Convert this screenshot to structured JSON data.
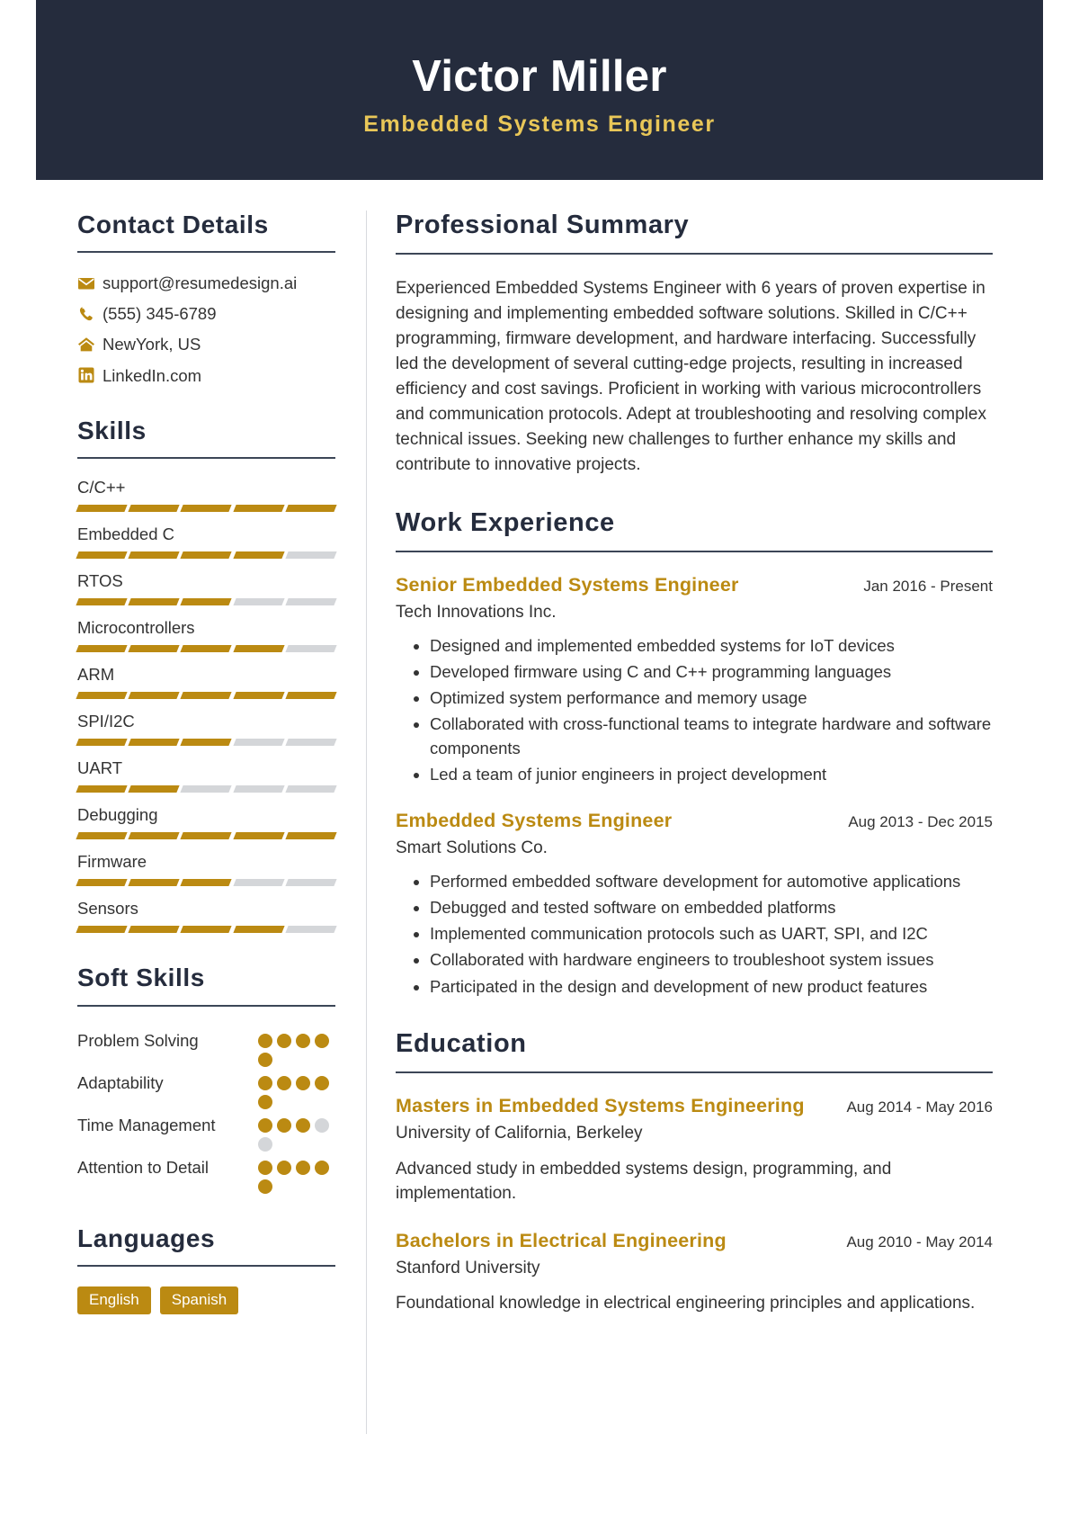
{
  "header": {
    "name": "Victor Miller",
    "title": "Embedded Systems Engineer",
    "bg_color": "#252c3d",
    "accent_color": "#e9c758"
  },
  "accent": {
    "gold": "#bb8a12",
    "navy": "#252c3d",
    "gray": "#d4d6d9"
  },
  "sidebar": {
    "contact": {
      "heading": "Contact Details",
      "items": [
        {
          "icon": "envelope-icon",
          "value": "support@resumedesign.ai"
        },
        {
          "icon": "phone-icon",
          "value": "(555) 345-6789"
        },
        {
          "icon": "home-icon",
          "value": "NewYork, US"
        },
        {
          "icon": "linkedin-icon",
          "value": "LinkedIn.com"
        }
      ]
    },
    "skills": {
      "heading": "Skills",
      "max": 5,
      "items": [
        {
          "name": "C/C++",
          "level": 5
        },
        {
          "name": "Embedded C",
          "level": 4
        },
        {
          "name": "RTOS",
          "level": 3
        },
        {
          "name": "Microcontrollers",
          "level": 4
        },
        {
          "name": "ARM",
          "level": 5
        },
        {
          "name": "SPI/I2C",
          "level": 3
        },
        {
          "name": "UART",
          "level": 2
        },
        {
          "name": "Debugging",
          "level": 5
        },
        {
          "name": "Firmware",
          "level": 3
        },
        {
          "name": "Sensors",
          "level": 4
        }
      ]
    },
    "soft_skills": {
      "heading": "Soft Skills",
      "max": 5,
      "items": [
        {
          "name": "Problem Solving",
          "level": 5
        },
        {
          "name": "Adaptability",
          "level": 5
        },
        {
          "name": "Time Management",
          "level": 3
        },
        {
          "name": "Attention to Detail",
          "level": 5
        }
      ]
    },
    "languages": {
      "heading": "Languages",
      "items": [
        "English",
        "Spanish"
      ]
    }
  },
  "main": {
    "summary": {
      "heading": "Professional Summary",
      "text": "Experienced Embedded Systems Engineer with 6 years of proven expertise in designing and implementing embedded software solutions. Skilled in C/C++ programming, firmware development, and hardware interfacing. Successfully led the development of several cutting-edge projects, resulting in increased efficiency and cost savings. Proficient in working with various microcontrollers and communication protocols. Adept at troubleshooting and resolving complex technical issues. Seeking new challenges to further enhance my skills and contribute to innovative projects."
    },
    "work": {
      "heading": "Work Experience",
      "entries": [
        {
          "role": "Senior Embedded Systems Engineer",
          "date": "Jan 2016 - Present",
          "org": "Tech Innovations Inc.",
          "bullets": [
            "Designed and implemented embedded systems for IoT devices",
            "Developed firmware using C and C++ programming languages",
            "Optimized system performance and memory usage",
            "Collaborated with cross-functional teams to integrate hardware and software components",
            "Led a team of junior engineers in project development"
          ]
        },
        {
          "role": "Embedded Systems Engineer",
          "date": "Aug 2013 - Dec 2015",
          "org": "Smart Solutions Co.",
          "bullets": [
            "Performed embedded software development for automotive applications",
            "Debugged and tested software on embedded platforms",
            "Implemented communication protocols such as UART, SPI, and I2C",
            "Collaborated with hardware engineers to troubleshoot system issues",
            "Participated in the design and development of new product features"
          ]
        }
      ]
    },
    "education": {
      "heading": "Education",
      "entries": [
        {
          "degree": "Masters in Embedded Systems Engineering",
          "date": "Aug 2014 - May 2016",
          "school": "University of California, Berkeley",
          "description": "Advanced study in embedded systems design, programming, and implementation."
        },
        {
          "degree": "Bachelors in Electrical Engineering",
          "date": "Aug 2010 - May 2014",
          "school": "Stanford University",
          "description": "Foundational knowledge in electrical engineering principles and applications."
        }
      ]
    }
  }
}
